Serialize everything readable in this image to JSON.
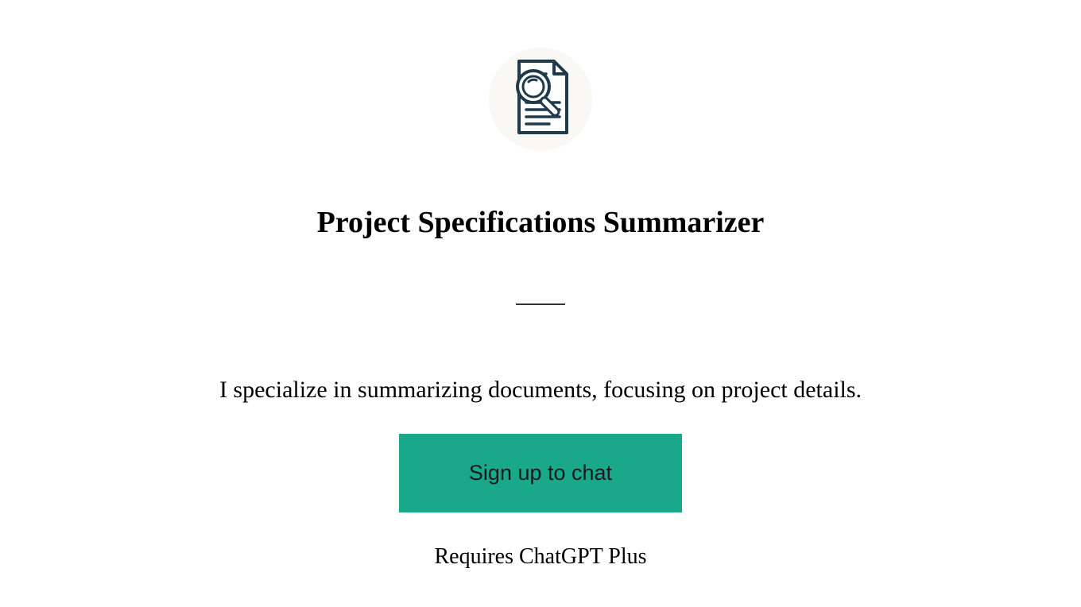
{
  "hero": {
    "title": "Project Specifications Summarizer",
    "description": "I specialize in summarizing documents, focusing on project details.",
    "cta_label": "Sign up to chat",
    "requires_note": "Requires ChatGPT Plus"
  },
  "icon": {
    "name": "document-magnifier-icon"
  },
  "colors": {
    "accent": "#19a98a",
    "background": "#ffffff"
  }
}
